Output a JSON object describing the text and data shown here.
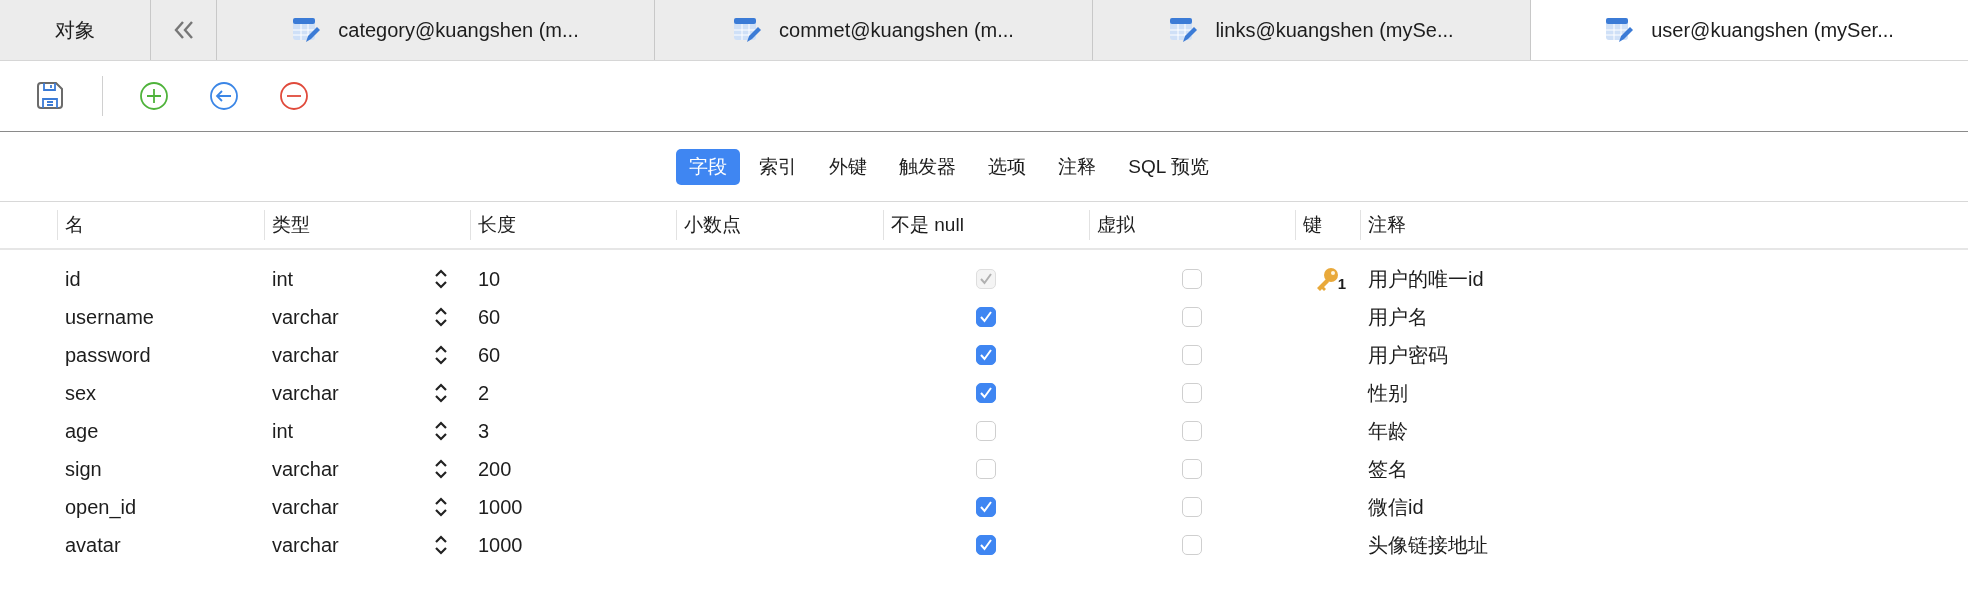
{
  "tab_bar": {
    "objects_tab": {
      "label": "对象",
      "selected": false
    },
    "tabs": [
      {
        "label": "category@kuangshen (m...",
        "selected": false
      },
      {
        "label": "commet@kuangshen (m...",
        "selected": false
      },
      {
        "label": "links@kuangshen (mySe...",
        "selected": false
      },
      {
        "label": "user@kuangshen (mySer...",
        "selected": true
      }
    ]
  },
  "segments": [
    {
      "label": "字段",
      "selected": true
    },
    {
      "label": "索引",
      "selected": false
    },
    {
      "label": "外键",
      "selected": false
    },
    {
      "label": "触发器",
      "selected": false
    },
    {
      "label": "选项",
      "selected": false
    },
    {
      "label": "注释",
      "selected": false
    },
    {
      "label": "SQL 预览",
      "selected": false
    }
  ],
  "table": {
    "columns": [
      "名",
      "类型",
      "长度",
      "小数点",
      "不是 null",
      "虚拟",
      "键",
      "注释"
    ],
    "rows": [
      {
        "name": "id",
        "type": "int",
        "length": "10",
        "not_null": {
          "checked": true,
          "disabled": true
        },
        "virtual": false,
        "key": "1",
        "comment": "用户的唯一id"
      },
      {
        "name": "username",
        "type": "varchar",
        "length": "60",
        "not_null": {
          "checked": true,
          "disabled": false
        },
        "virtual": false,
        "comment": "用户名"
      },
      {
        "name": "password",
        "type": "varchar",
        "length": "60",
        "not_null": {
          "checked": true,
          "disabled": false
        },
        "virtual": false,
        "comment": "用户密码"
      },
      {
        "name": "sex",
        "type": "varchar",
        "length": "2",
        "not_null": {
          "checked": true,
          "disabled": false
        },
        "virtual": false,
        "comment": "性别"
      },
      {
        "name": "age",
        "type": "int",
        "length": "3",
        "not_null": {
          "checked": false,
          "disabled": false
        },
        "virtual": false,
        "comment": "年龄"
      },
      {
        "name": "sign",
        "type": "varchar",
        "length": "200",
        "not_null": {
          "checked": false,
          "disabled": false
        },
        "virtual": false,
        "comment": "签名"
      },
      {
        "name": "open_id",
        "type": "varchar",
        "length": "1000",
        "not_null": {
          "checked": true,
          "disabled": false
        },
        "virtual": false,
        "comment": "微信id"
      },
      {
        "name": "avatar",
        "type": "varchar",
        "length": "1000",
        "not_null": {
          "checked": true,
          "disabled": false
        },
        "virtual": false,
        "comment": "头像链接地址"
      }
    ]
  }
}
